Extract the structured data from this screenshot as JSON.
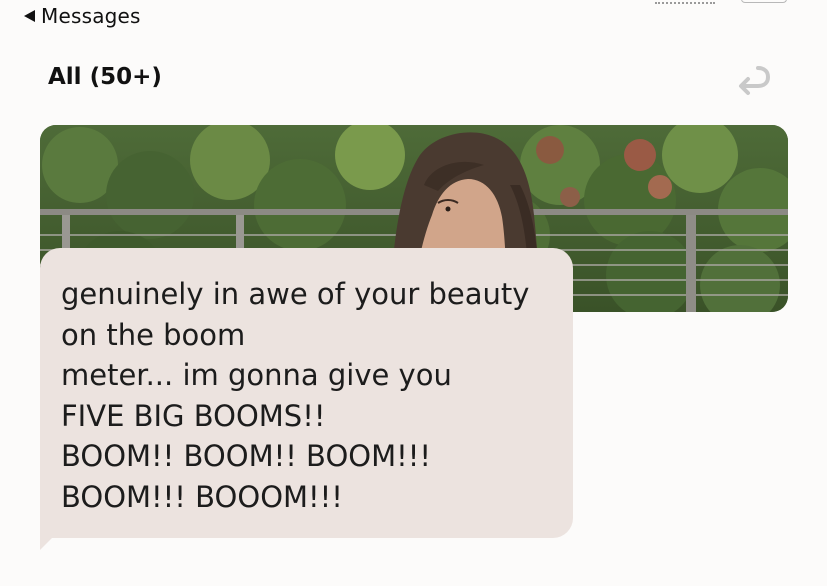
{
  "header": {
    "back_label": "Messages",
    "back_icon": "left-triangle-icon",
    "filter_title": "All (50+)",
    "reply_icon": "reply-arrow-icon"
  },
  "photo": {
    "description_icon": "profile-photo"
  },
  "message": {
    "lines": [
      "genuinely in awe of your beauty",
      "on the boom",
      "meter... im gonna give you",
      "FIVE BIG BOOMS!!",
      "BOOM!! BOOM!! BOOM!!!",
      "BOOM!!! BOOOM!!!"
    ]
  },
  "colors": {
    "background": "#fcfbfa",
    "bubble": "#ece3df",
    "text": "#1c1c1c",
    "icon_muted": "#c9c9c9"
  }
}
